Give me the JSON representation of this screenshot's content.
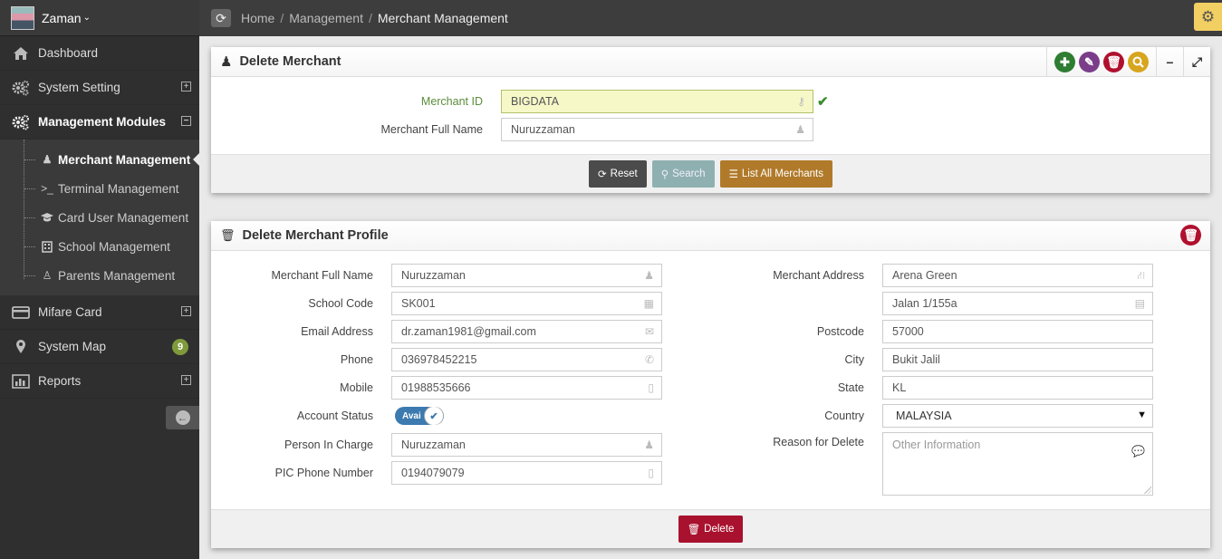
{
  "user": {
    "name": "Zaman",
    "caret": "⌄"
  },
  "sidebar": {
    "items": [
      {
        "label": "Dashboard",
        "icon": "home-icon"
      },
      {
        "label": "System Setting",
        "icon": "gears-icon",
        "expander": "+"
      },
      {
        "label": "Management Modules",
        "icon": "gears-icon",
        "expander": "−"
      },
      {
        "label": "Mifare Card",
        "icon": "card-icon",
        "expander": "+"
      },
      {
        "label": "System Map",
        "icon": "map-marker-icon",
        "badge": "9"
      },
      {
        "label": "Reports",
        "icon": "bar-chart-icon",
        "expander": "+"
      }
    ],
    "sub_items": [
      {
        "label": "Merchant Management",
        "icon": "user-icon"
      },
      {
        "label": "Terminal Management",
        "icon": "terminal-icon"
      },
      {
        "label": "Card User Management",
        "icon": "graduation-cap-icon"
      },
      {
        "label": "School Management",
        "icon": "building-icon"
      },
      {
        "label": "Parents Management",
        "icon": "female-icon"
      }
    ]
  },
  "breadcrumb": {
    "home": "Home",
    "section": "Management",
    "current": "Merchant Management",
    "sep": "/"
  },
  "search_panel": {
    "title": "Delete Merchant",
    "merchant_id_label": "Merchant ID",
    "merchant_id_value": "BIGDATA",
    "full_name_label": "Merchant Full Name",
    "full_name_value": "Nuruzzaman",
    "reset_label": "Reset",
    "search_label": "Search",
    "list_label": "List All Merchants"
  },
  "profile_panel": {
    "title": "Delete Merchant Profile",
    "left_fields": [
      {
        "label": "Merchant Full Name",
        "value": "Nuruzzaman",
        "icon": "user-icon"
      },
      {
        "label": "School Code",
        "value": "SK001",
        "icon": "building-icon"
      },
      {
        "label": "Email Address",
        "value": "dr.zaman1981@gmail.com",
        "icon": "envelope-icon"
      },
      {
        "label": "Phone",
        "value": "036978452215",
        "icon": "phone-icon"
      },
      {
        "label": "Mobile",
        "value": "01988535666",
        "icon": "mobile-icon"
      }
    ],
    "account_status_label": "Account Status",
    "account_status_value": "Avai",
    "person_in_charge_label": "Person In Charge",
    "person_in_charge_value": "Nuruzzaman",
    "pic_phone_label": "PIC Phone Number",
    "pic_phone_value": "0194079079",
    "address_label": "Merchant Address",
    "address_line1": "Arena Green",
    "address_line2": "Jalan 1/155a",
    "postcode_label": "Postcode",
    "postcode_value": "57000",
    "city_label": "City",
    "city_value": "Bukit Jalil",
    "state_label": "State",
    "state_value": "KL",
    "country_label": "Country",
    "country_value": "MALAYSIA",
    "reason_label": "Reason for Delete",
    "reason_placeholder": "Other Information",
    "delete_label": "Delete"
  },
  "colors": {
    "add": "#2e7d32",
    "edit": "#7b3d8a",
    "delete": "#b0102e",
    "search": "#d8a51f",
    "accent": "#f2cf62"
  }
}
